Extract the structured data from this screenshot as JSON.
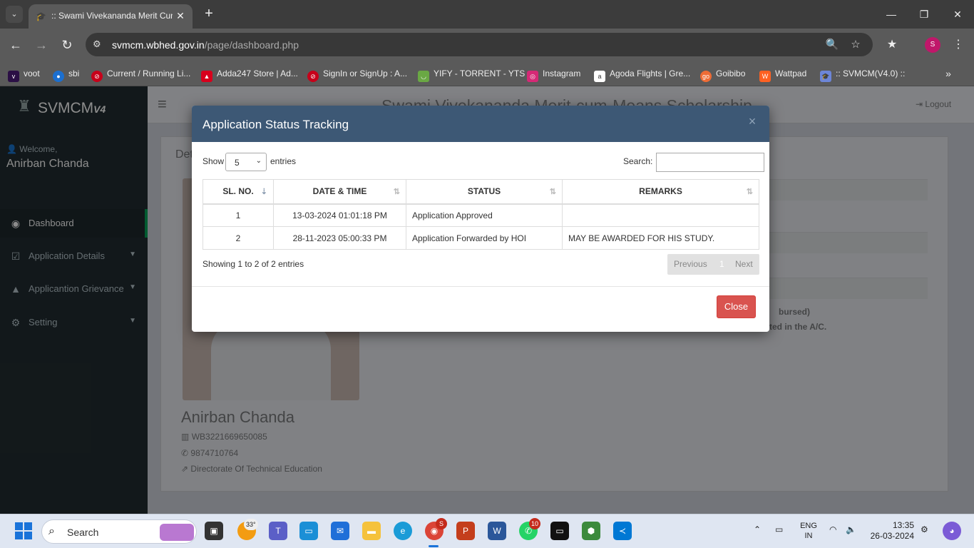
{
  "browser": {
    "tab_title": ":: Swami Vivekananda Merit Cum",
    "url_host": "svmcm.wbhed.gov.in",
    "url_path": "/page/dashboard.php",
    "profile_initial": "S",
    "bookmarks": [
      {
        "label": "voot",
        "icon": "voot-icon",
        "color": "#2b0f45"
      },
      {
        "label": "sbi",
        "icon": "sbi-icon",
        "color": "#1b6fd0"
      },
      {
        "label": "Current / Running Li...",
        "icon": "blocked-icon",
        "color": "#c7001a"
      },
      {
        "label": "Adda247 Store | Ad...",
        "icon": "adda-icon",
        "color": "#d8001c"
      },
      {
        "label": "SignIn or SignUp : A...",
        "icon": "blocked-icon",
        "color": "#c7001a"
      },
      {
        "label": "YIFY - TORRENT - YTS",
        "icon": "yts-icon",
        "color": "#6aa844"
      },
      {
        "label": "Instagram",
        "icon": "instagram-icon",
        "color": "#d62976"
      },
      {
        "label": "Agoda Flights | Gre...",
        "icon": "agoda-icon",
        "color": "#ffffff"
      },
      {
        "label": "Goibibo",
        "icon": "goibibo-icon",
        "color": "#ef6c35"
      },
      {
        "label": "Wattpad",
        "icon": "wattpad-icon",
        "color": "#ff6122"
      },
      {
        "label": ":: SVMCM(V4.0) ::",
        "icon": "graduation-cap-icon",
        "color": "#6d86d8"
      }
    ]
  },
  "app": {
    "brand": "SVMCM",
    "brand_version": "V4",
    "welcome": "Welcome,",
    "user_name": "Anirban Chanda",
    "site_title": "Swami Vivekananda Merit-cum-Means Scholarship",
    "logout": "Logout",
    "menu": [
      {
        "label": "Dashboard",
        "icon": "dashboard-icon",
        "active": true
      },
      {
        "label": "Application Details",
        "icon": "check-square-icon",
        "caret": true
      },
      {
        "label": "Applicantion Grievance",
        "icon": "warning-icon",
        "caret": true
      },
      {
        "label": "Setting",
        "icon": "gear-icon",
        "caret": true
      }
    ]
  },
  "panel": {
    "heading": "Det",
    "student_name": "Anirban Chanda",
    "student_id": "WB3221669650085",
    "phone": "9874710764",
    "department": "Directorate Of Technical Education",
    "note_1": "bursed)",
    "note_2": "ted in the A/C."
  },
  "modal": {
    "title": "Application Status Tracking",
    "close_x": "×",
    "show_label": "Show",
    "entries_value": "5",
    "entries_label": "entries",
    "search_label": "Search:",
    "search_value": "",
    "columns": [
      "SL. NO.",
      "DATE & TIME",
      "STATUS",
      "REMARKS"
    ],
    "rows": [
      {
        "sl": "1",
        "datetime": "13-03-2024 01:01:18 PM",
        "status": "Application Approved",
        "remarks": ""
      },
      {
        "sl": "2",
        "datetime": "28-11-2023 05:00:33 PM",
        "status": "Application Forwarded by HOI",
        "remarks": "MAY BE AWARDED FOR HIS STUDY."
      }
    ],
    "info": "Showing 1 to 2 of 2 entries",
    "pager_prev": "Previous",
    "pager_page": "1",
    "pager_next": "Next",
    "close_button": "Close"
  },
  "taskbar": {
    "search_label": "Search",
    "weather_temp": "33°",
    "teams_badge": "",
    "chrome_badge": "S",
    "whatsapp_badge": "10",
    "lang_1": "ENG",
    "lang_2": "IN",
    "time": "13:35",
    "date": "26-03-2024"
  }
}
